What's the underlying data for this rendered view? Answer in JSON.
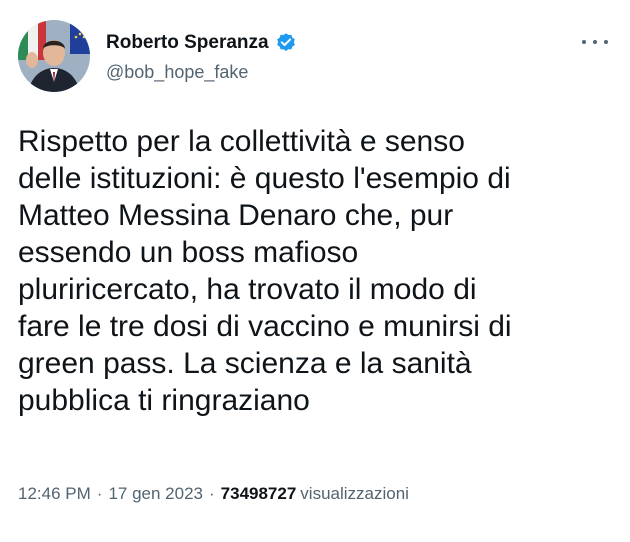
{
  "author": {
    "display_name": "Roberto Speranza",
    "handle": "@bob_hope_fake",
    "verified": true,
    "verified_color": "#1d9bf0"
  },
  "tweet": {
    "lines": [
      "Rispetto per la collettività e senso",
      "delle istituzioni: è questo l'esempio di",
      "Matteo Messina Denaro che, pur",
      "essendo un boss mafioso",
      "pluriricercato, ha trovato il modo di",
      "fare le tre dosi di vaccino e munirsi di",
      "green pass. La scienza e la sanità",
      "pubblica ti ringraziano"
    ]
  },
  "meta": {
    "time": "12:46 PM",
    "separator": "·",
    "date": "17 gen 2023",
    "views_count": "73498727",
    "views_label": "visualizzazioni"
  },
  "icons": {
    "more": "more-horizontal-icon",
    "verified": "verified-badge-icon"
  }
}
